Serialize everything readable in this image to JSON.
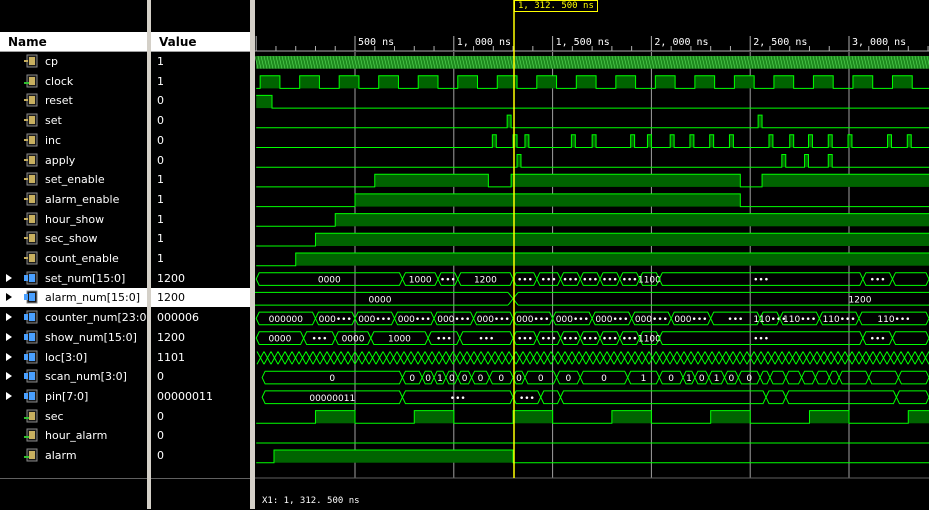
{
  "headers": {
    "name": "Name",
    "value": "Value"
  },
  "signals": [
    {
      "name": "cp",
      "value": "1",
      "kind": "in",
      "bus": false
    },
    {
      "name": "clock",
      "value": "1",
      "kind": "out",
      "bus": false
    },
    {
      "name": "reset",
      "value": "0",
      "kind": "in",
      "bus": false
    },
    {
      "name": "set",
      "value": "0",
      "kind": "in",
      "bus": false
    },
    {
      "name": "inc",
      "value": "0",
      "kind": "in",
      "bus": false
    },
    {
      "name": "apply",
      "value": "0",
      "kind": "in",
      "bus": false
    },
    {
      "name": "set_enable",
      "value": "1",
      "kind": "in",
      "bus": false
    },
    {
      "name": "alarm_enable",
      "value": "1",
      "kind": "in",
      "bus": false
    },
    {
      "name": "hour_show",
      "value": "1",
      "kind": "in",
      "bus": false
    },
    {
      "name": "sec_show",
      "value": "1",
      "kind": "in",
      "bus": false
    },
    {
      "name": "count_enable",
      "value": "1",
      "kind": "in",
      "bus": false
    },
    {
      "name": "set_num[15:0]",
      "value": "1200",
      "kind": "bus",
      "bus": true
    },
    {
      "name": "alarm_num[15:0]",
      "value": "1200",
      "kind": "bus",
      "bus": true,
      "selected": true
    },
    {
      "name": "counter_num[23:0]",
      "value": "000006",
      "kind": "bus",
      "bus": true
    },
    {
      "name": "show_num[15:0]",
      "value": "1200",
      "kind": "bus",
      "bus": true
    },
    {
      "name": "loc[3:0]",
      "value": "1101",
      "kind": "bus",
      "bus": true
    },
    {
      "name": "scan_num[3:0]",
      "value": "0",
      "kind": "bus",
      "bus": true
    },
    {
      "name": "pin[7:0]",
      "value": "00000011",
      "kind": "bus",
      "bus": true
    },
    {
      "name": "sec",
      "value": "0",
      "kind": "out",
      "bus": false
    },
    {
      "name": "hour_alarm",
      "value": "0",
      "kind": "out",
      "bus": false
    },
    {
      "name": "alarm",
      "value": "0",
      "kind": "out",
      "bus": false
    }
  ],
  "timeline": {
    "ticks": [
      "500 ns",
      "1, 000 ns",
      "1, 500 ns",
      "2, 000 ns",
      "2, 500 ns",
      "3, 000 ns"
    ],
    "cursor_label": "1, 312. 500 ns",
    "status": "X1: 1, 312. 500 ns"
  },
  "bus_labels": {
    "set_num": [
      "0000",
      "1000",
      "•••",
      "1200",
      "•••",
      "•••",
      "•••",
      "•••",
      "•••",
      "•••",
      "1100",
      "•••",
      "•••"
    ],
    "alarm_num": [
      "0000",
      "1200"
    ],
    "counter_num": [
      "000000",
      "000•••",
      "000•••",
      "000•••",
      "000•••",
      "000•••",
      "000•••",
      "000•••",
      "000•••",
      "000•••",
      "000•••",
      "•••",
      "110•••",
      "110•••",
      "110•••",
      "110•••"
    ],
    "show_num": [
      "0000",
      "•••",
      "0000",
      "1000",
      "•••",
      "•••",
      "•••",
      "•••",
      "•••",
      "•••",
      "•••",
      "•••",
      "1100",
      "•••",
      "•••"
    ],
    "scan_num": [
      "0",
      "0",
      "0",
      "1",
      "0",
      "0",
      "0",
      "0",
      "0",
      "0",
      "0",
      "0",
      "1",
      "0",
      "1",
      "0",
      "1",
      "0",
      "0"
    ],
    "pin": [
      "00000011",
      "•••",
      "•••"
    ]
  },
  "colors": {
    "wave": "#00ff00",
    "wave_fill": "#006400",
    "cursor": "#ffff00",
    "grid": "#b0b0b0",
    "bus_x": "#00ff00"
  }
}
